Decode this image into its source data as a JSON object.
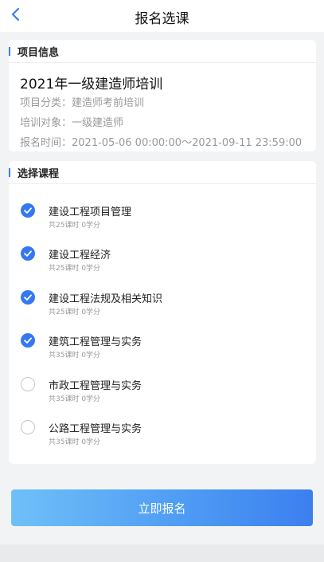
{
  "nav": {
    "title": "报名选课"
  },
  "info": {
    "section_title": "项目信息",
    "project_title": "2021年一级建造师培训",
    "category": "项目分类：建造师考前培训",
    "target": "培训对象：一级建造师",
    "period": "报名时间：2021-05-06 00:00:00～2021-09-11 23:59:00"
  },
  "courses": {
    "section_title": "选择课程",
    "items": [
      {
        "name": "建设工程项目管理",
        "sub": "共25课时 0学分",
        "checked": true
      },
      {
        "name": "建设工程经济",
        "sub": "共25课时 0学分",
        "checked": true
      },
      {
        "name": "建设工程法规及相关知识",
        "sub": "共25课时 0学分",
        "checked": true
      },
      {
        "name": "建筑工程管理与实务",
        "sub": "共35课时 0学分",
        "checked": true
      },
      {
        "name": "市政工程管理与实务",
        "sub": "共35课时 0学分",
        "checked": false
      },
      {
        "name": "公路工程管理与实务",
        "sub": "共35课时 0学分",
        "checked": false
      }
    ]
  },
  "submit": {
    "label": "立即报名"
  },
  "colors": {
    "accent": "#3478f2",
    "muted_text": "#9a9a9a"
  },
  "icons": {
    "back": "chevron-left-icon",
    "checked": "check-circle-icon",
    "unchecked": "empty-circle-icon"
  }
}
